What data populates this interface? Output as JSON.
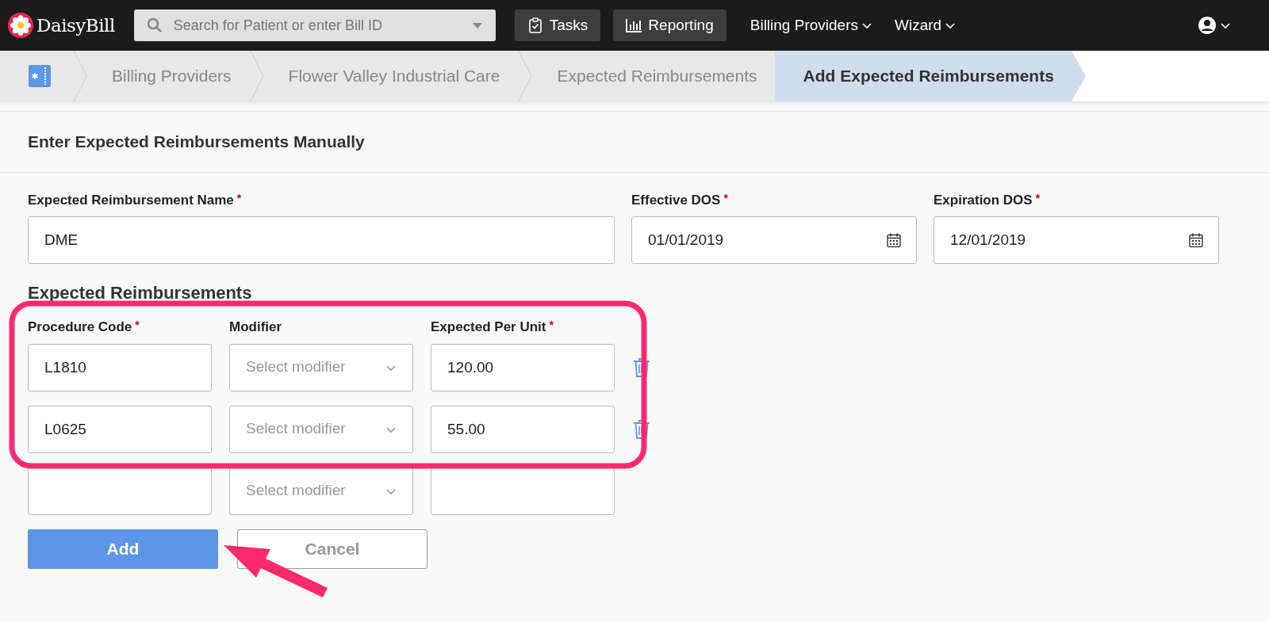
{
  "navbar": {
    "brand": "DaisyBill",
    "search": {
      "placeholder": "Search for Patient or enter Bill ID"
    },
    "items": [
      {
        "label": "Tasks",
        "kind": "button"
      },
      {
        "label": "Reporting",
        "kind": "button"
      },
      {
        "label": "Billing Providers",
        "kind": "dropdown"
      },
      {
        "label": "Wizard",
        "kind": "dropdown"
      }
    ]
  },
  "breadcrumbs": [
    {
      "label": "Billing Providers",
      "selected": false
    },
    {
      "label": "Flower Valley Industrial Care",
      "selected": false
    },
    {
      "label": "Expected Reimbursements",
      "selected": false
    },
    {
      "label": "Add Expected Reimbursements",
      "selected": true
    }
  ],
  "form": {
    "title": "Enter Expected Reimbursements Manually",
    "required_mark": "*",
    "fields": [
      {
        "label": "Expected Reimbursement Name",
        "required": true,
        "value": "DME",
        "kind": "text"
      },
      {
        "label": "Effective DOS",
        "required": true,
        "value": "01/01/2019",
        "kind": "date"
      },
      {
        "label": "Expiration DOS",
        "required": true,
        "value": "12/01/2019",
        "kind": "date"
      }
    ],
    "section_title": "Expected Reimbursements",
    "columns": [
      {
        "label": "Procedure Code",
        "required": true
      },
      {
        "label": "Modifier",
        "required": false
      },
      {
        "label": "Expected Per Unit",
        "required": true
      }
    ],
    "rows": [
      {
        "procedure_code": "L1810",
        "modifier_placeholder": "Select modifier",
        "expected": "120.00",
        "deletable": true
      },
      {
        "procedure_code": "L0625",
        "modifier_placeholder": "Select modifier",
        "expected": "55.00",
        "deletable": true
      },
      {
        "modifier_placeholder": "Select modifier",
        "deletable": false
      }
    ],
    "buttons": [
      {
        "label": "Add",
        "kind": "primary"
      },
      {
        "label": "Cancel",
        "kind": "secondary"
      }
    ]
  },
  "annotations": {
    "highlight_frame": true,
    "arrow": true
  }
}
